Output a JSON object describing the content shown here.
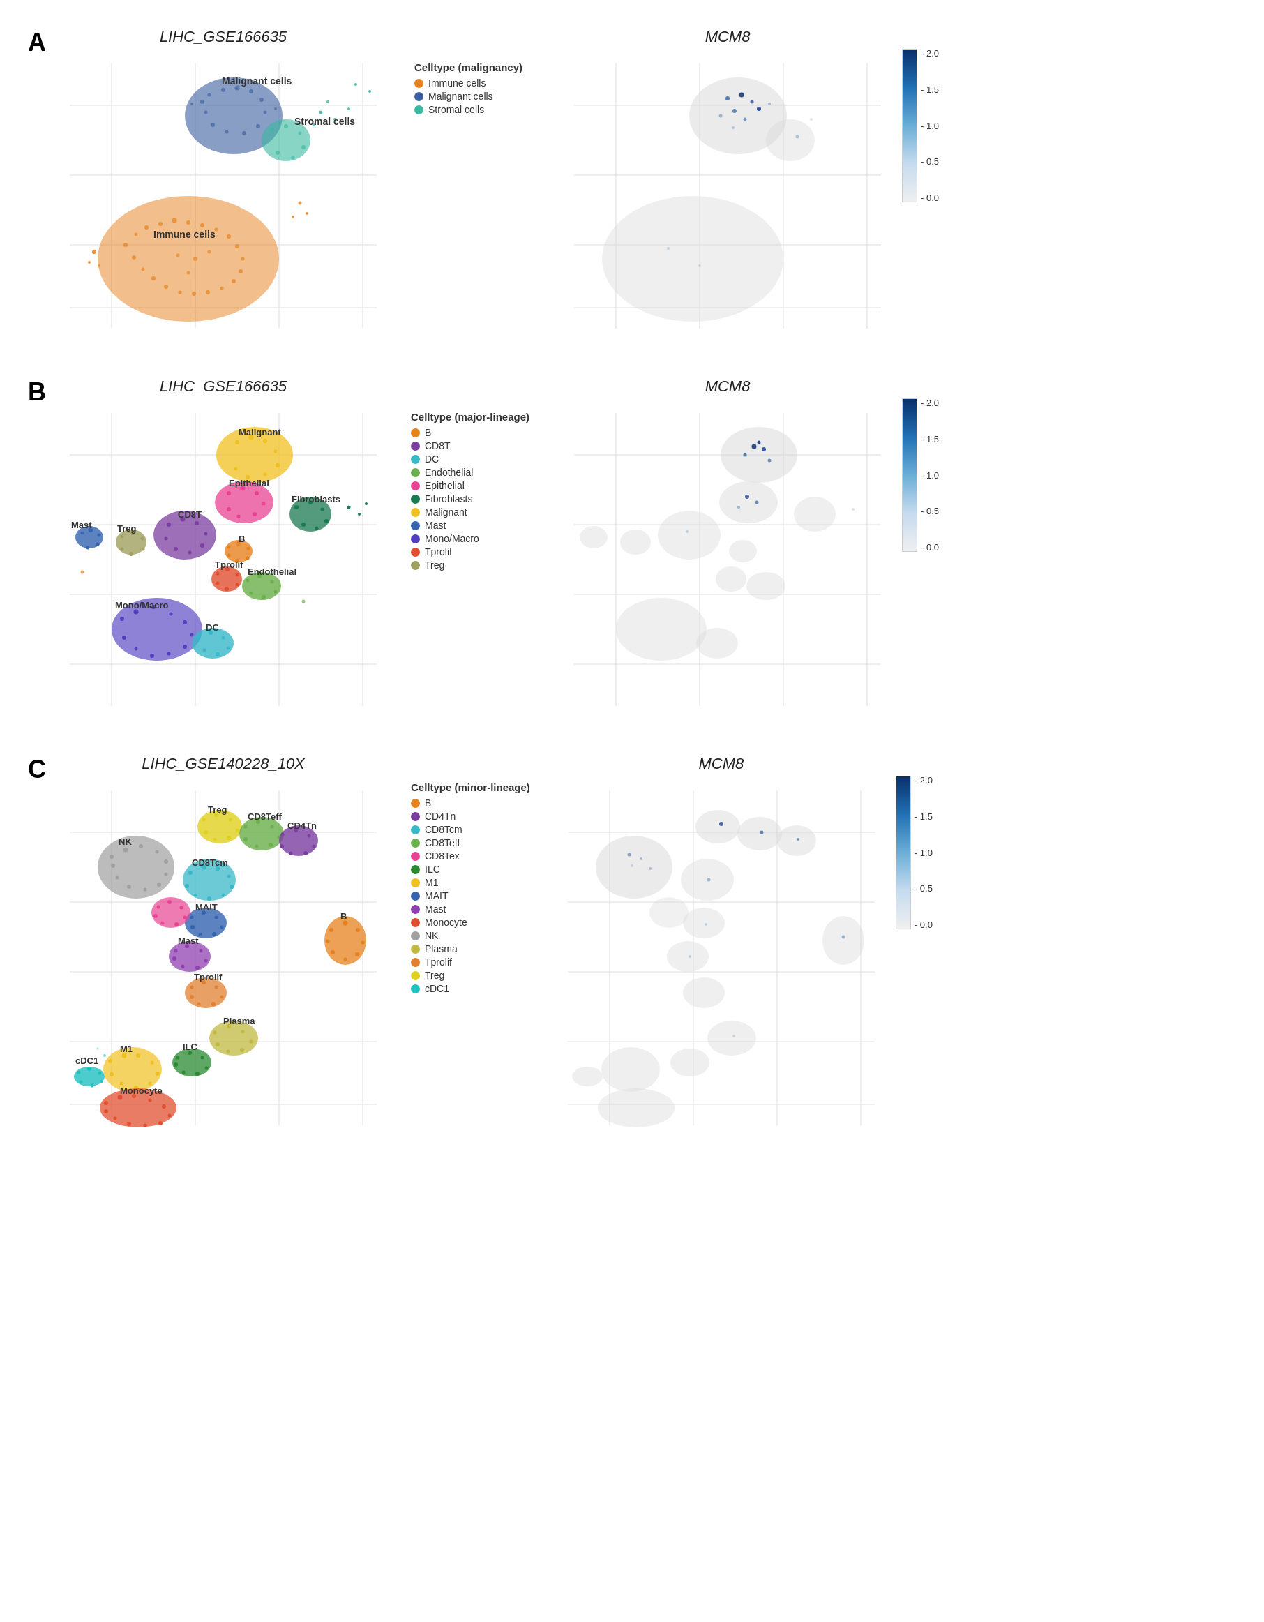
{
  "panels": {
    "A": {
      "label": "A",
      "left_title": "LIHC_GSE166635",
      "right_title": "MCM8",
      "legend_title": "Celltype (malignancy)",
      "legend_items": [
        {
          "label": "Immune cells",
          "color": "#e6821e"
        },
        {
          "label": "Malignant cells",
          "color": "#3b5fa0"
        },
        {
          "label": "Stromal cells",
          "color": "#3ab8a0"
        }
      ],
      "colorbar_ticks": [
        "2.0",
        "1.5",
        "1.0",
        "0.5",
        "0.0"
      ]
    },
    "B": {
      "label": "B",
      "left_title": "LIHC_GSE166635",
      "right_title": "MCM8",
      "legend_title": "Celltype (major-lineage)",
      "legend_items": [
        {
          "label": "B",
          "color": "#e6821e"
        },
        {
          "label": "CD8T",
          "color": "#7b3fa0"
        },
        {
          "label": "DC",
          "color": "#3ab8c8"
        },
        {
          "label": "Endothelial",
          "color": "#6ab04c"
        },
        {
          "label": "Epithelial",
          "color": "#e84393"
        },
        {
          "label": "Fibroblasts",
          "color": "#1a7a50"
        },
        {
          "label": "Malignant",
          "color": "#f0c020"
        },
        {
          "label": "Mast",
          "color": "#3464b0"
        },
        {
          "label": "Mono/Macro",
          "color": "#5040c0"
        },
        {
          "label": "Tprolif",
          "color": "#e05030"
        },
        {
          "label": "Treg",
          "color": "#a0a060"
        }
      ],
      "colorbar_ticks": [
        "2.0",
        "1.5",
        "1.0",
        "0.5",
        "0.0"
      ]
    },
    "C": {
      "label": "C",
      "left_title": "LIHC_GSE140228_10X",
      "right_title": "MCM8",
      "legend_title": "Celltype (minor-lineage)",
      "legend_items": [
        {
          "label": "B",
          "color": "#e6821e"
        },
        {
          "label": "CD4Tn",
          "color": "#7b3fa0"
        },
        {
          "label": "CD8Tcm",
          "color": "#3ab8c8"
        },
        {
          "label": "CD8Teff",
          "color": "#6ab04c"
        },
        {
          "label": "CD8Tex",
          "color": "#e84393"
        },
        {
          "label": "ILC",
          "color": "#2a8a30"
        },
        {
          "label": "M1",
          "color": "#f0c020"
        },
        {
          "label": "MAIT",
          "color": "#3464b0"
        },
        {
          "label": "Mast",
          "color": "#9040b0"
        },
        {
          "label": "Monocyte",
          "color": "#e05030"
        },
        {
          "label": "NK",
          "color": "#a0a0a0"
        },
        {
          "label": "Plasma",
          "color": "#c0b840"
        },
        {
          "label": "Tprolif",
          "color": "#e08030"
        },
        {
          "label": "Treg",
          "color": "#e0d020"
        },
        {
          "label": "cDC1",
          "color": "#20c0c0"
        }
      ],
      "colorbar_ticks": [
        "2.0",
        "1.5",
        "1.0",
        "0.5",
        "0.0"
      ]
    }
  }
}
